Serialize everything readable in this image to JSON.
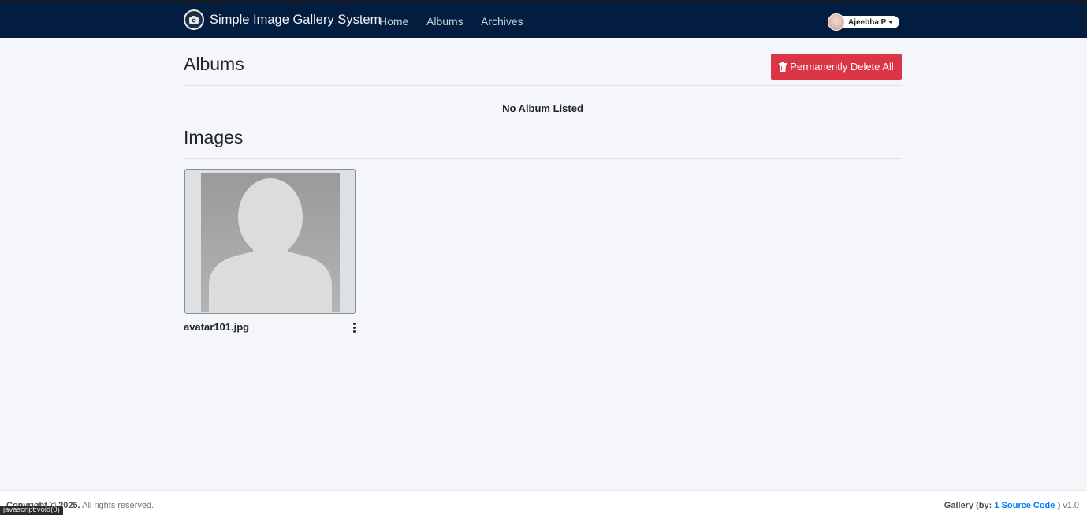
{
  "header": {
    "brand": "Simple Image Gallery System",
    "logo_icon": "camera-icon",
    "nav": [
      {
        "label": "Home"
      },
      {
        "label": "Albums"
      },
      {
        "label": "Archives"
      }
    ],
    "user": {
      "name": "Ajeebha P"
    }
  },
  "albums": {
    "title": "Albums",
    "delete_all_label": "Permanently Delete All",
    "empty_message": "No Album Listed"
  },
  "images": {
    "title": "Images",
    "items": [
      {
        "filename": "avatar101.jpg"
      }
    ]
  },
  "footer": {
    "copyright_prefix": "Copyright © 2025.",
    "rights": "All rights reserved.",
    "credit_prefix": "Gallery (by:",
    "credit_link": "1 Source Code",
    "credit_suffix": ")",
    "version": "v1.0"
  },
  "status_bar": {
    "url": "javascript:void(0)"
  },
  "colors": {
    "navbar": "#021d3f",
    "danger": "#dc3545",
    "background": "#f4f6f9",
    "link": "#007bff"
  }
}
